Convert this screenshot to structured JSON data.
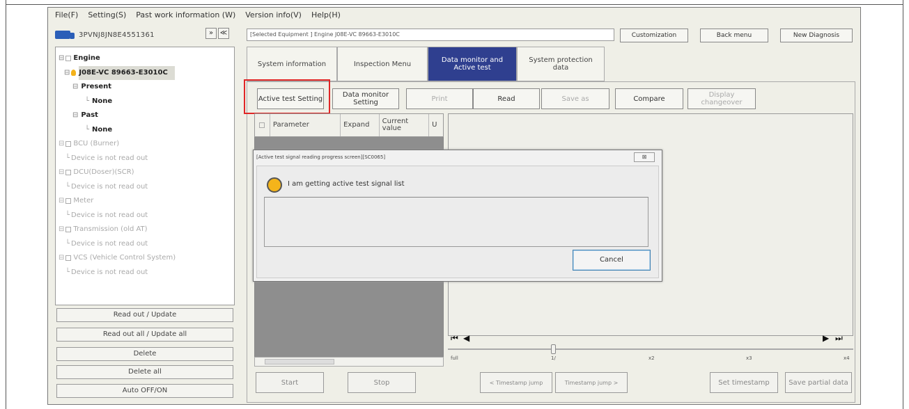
{
  "menu": [
    "File(F)",
    "Setting(S)",
    "Past work information (W)",
    "Version info(V)",
    "Help(H)"
  ],
  "left": {
    "vin": "3PVNJ8JN8E4551361",
    "expand_btn": "»",
    "collapse_btn": "≪",
    "tree": [
      {
        "label": "Engine"
      },
      {
        "label": "J08E-VC 89663-E3010C"
      },
      {
        "label": "Present"
      },
      {
        "label": "None"
      },
      {
        "label": "Past"
      },
      {
        "label": "None"
      },
      {
        "label": "BCU (Burner)"
      },
      {
        "label": "Device is not read out"
      },
      {
        "label": "DCU(Doser)(SCR)"
      },
      {
        "label": "Device is not read out"
      },
      {
        "label": "Meter"
      },
      {
        "label": "Device is not read out"
      },
      {
        "label": "Transmission (old AT)"
      },
      {
        "label": "Device is not read out"
      },
      {
        "label": "VCS (Vehicle Control System)"
      },
      {
        "label": "Device is not read out"
      }
    ],
    "buttons": [
      "Read out / Update",
      "Read out all / Update all",
      "Delete",
      "Delete all",
      "Auto OFF/ON"
    ]
  },
  "main": {
    "selected_equipment": "[Selected Equipment ] Engine J08E-VC 89663-E3010C",
    "top_buttons": [
      "Customization",
      "Back menu",
      "New Diagnosis"
    ],
    "tabs": [
      "System information",
      "Inspection Menu",
      "Data monitor and Active test",
      "System protection data"
    ],
    "toolbar": [
      "Active test Setting",
      "Data monitor Setting",
      "Print",
      "Read",
      "Save as",
      "Compare",
      "Display changeover"
    ],
    "grid_headers": [
      "Parameter",
      "Expand",
      "Current value",
      "U"
    ],
    "scale_labels": [
      "full",
      "1/",
      "x2",
      "x3",
      "x4"
    ],
    "bottom_buttons": [
      "Start",
      "Stop",
      "< Timestamp jump",
      "Timestamp jump >",
      "Set timestamp",
      "Save partial data"
    ]
  },
  "dialog": {
    "title": "[Active test signal reading progress screen][SC0065]",
    "close": "⊠",
    "message": "I am getting active test signal list",
    "cancel": "Cancel"
  }
}
